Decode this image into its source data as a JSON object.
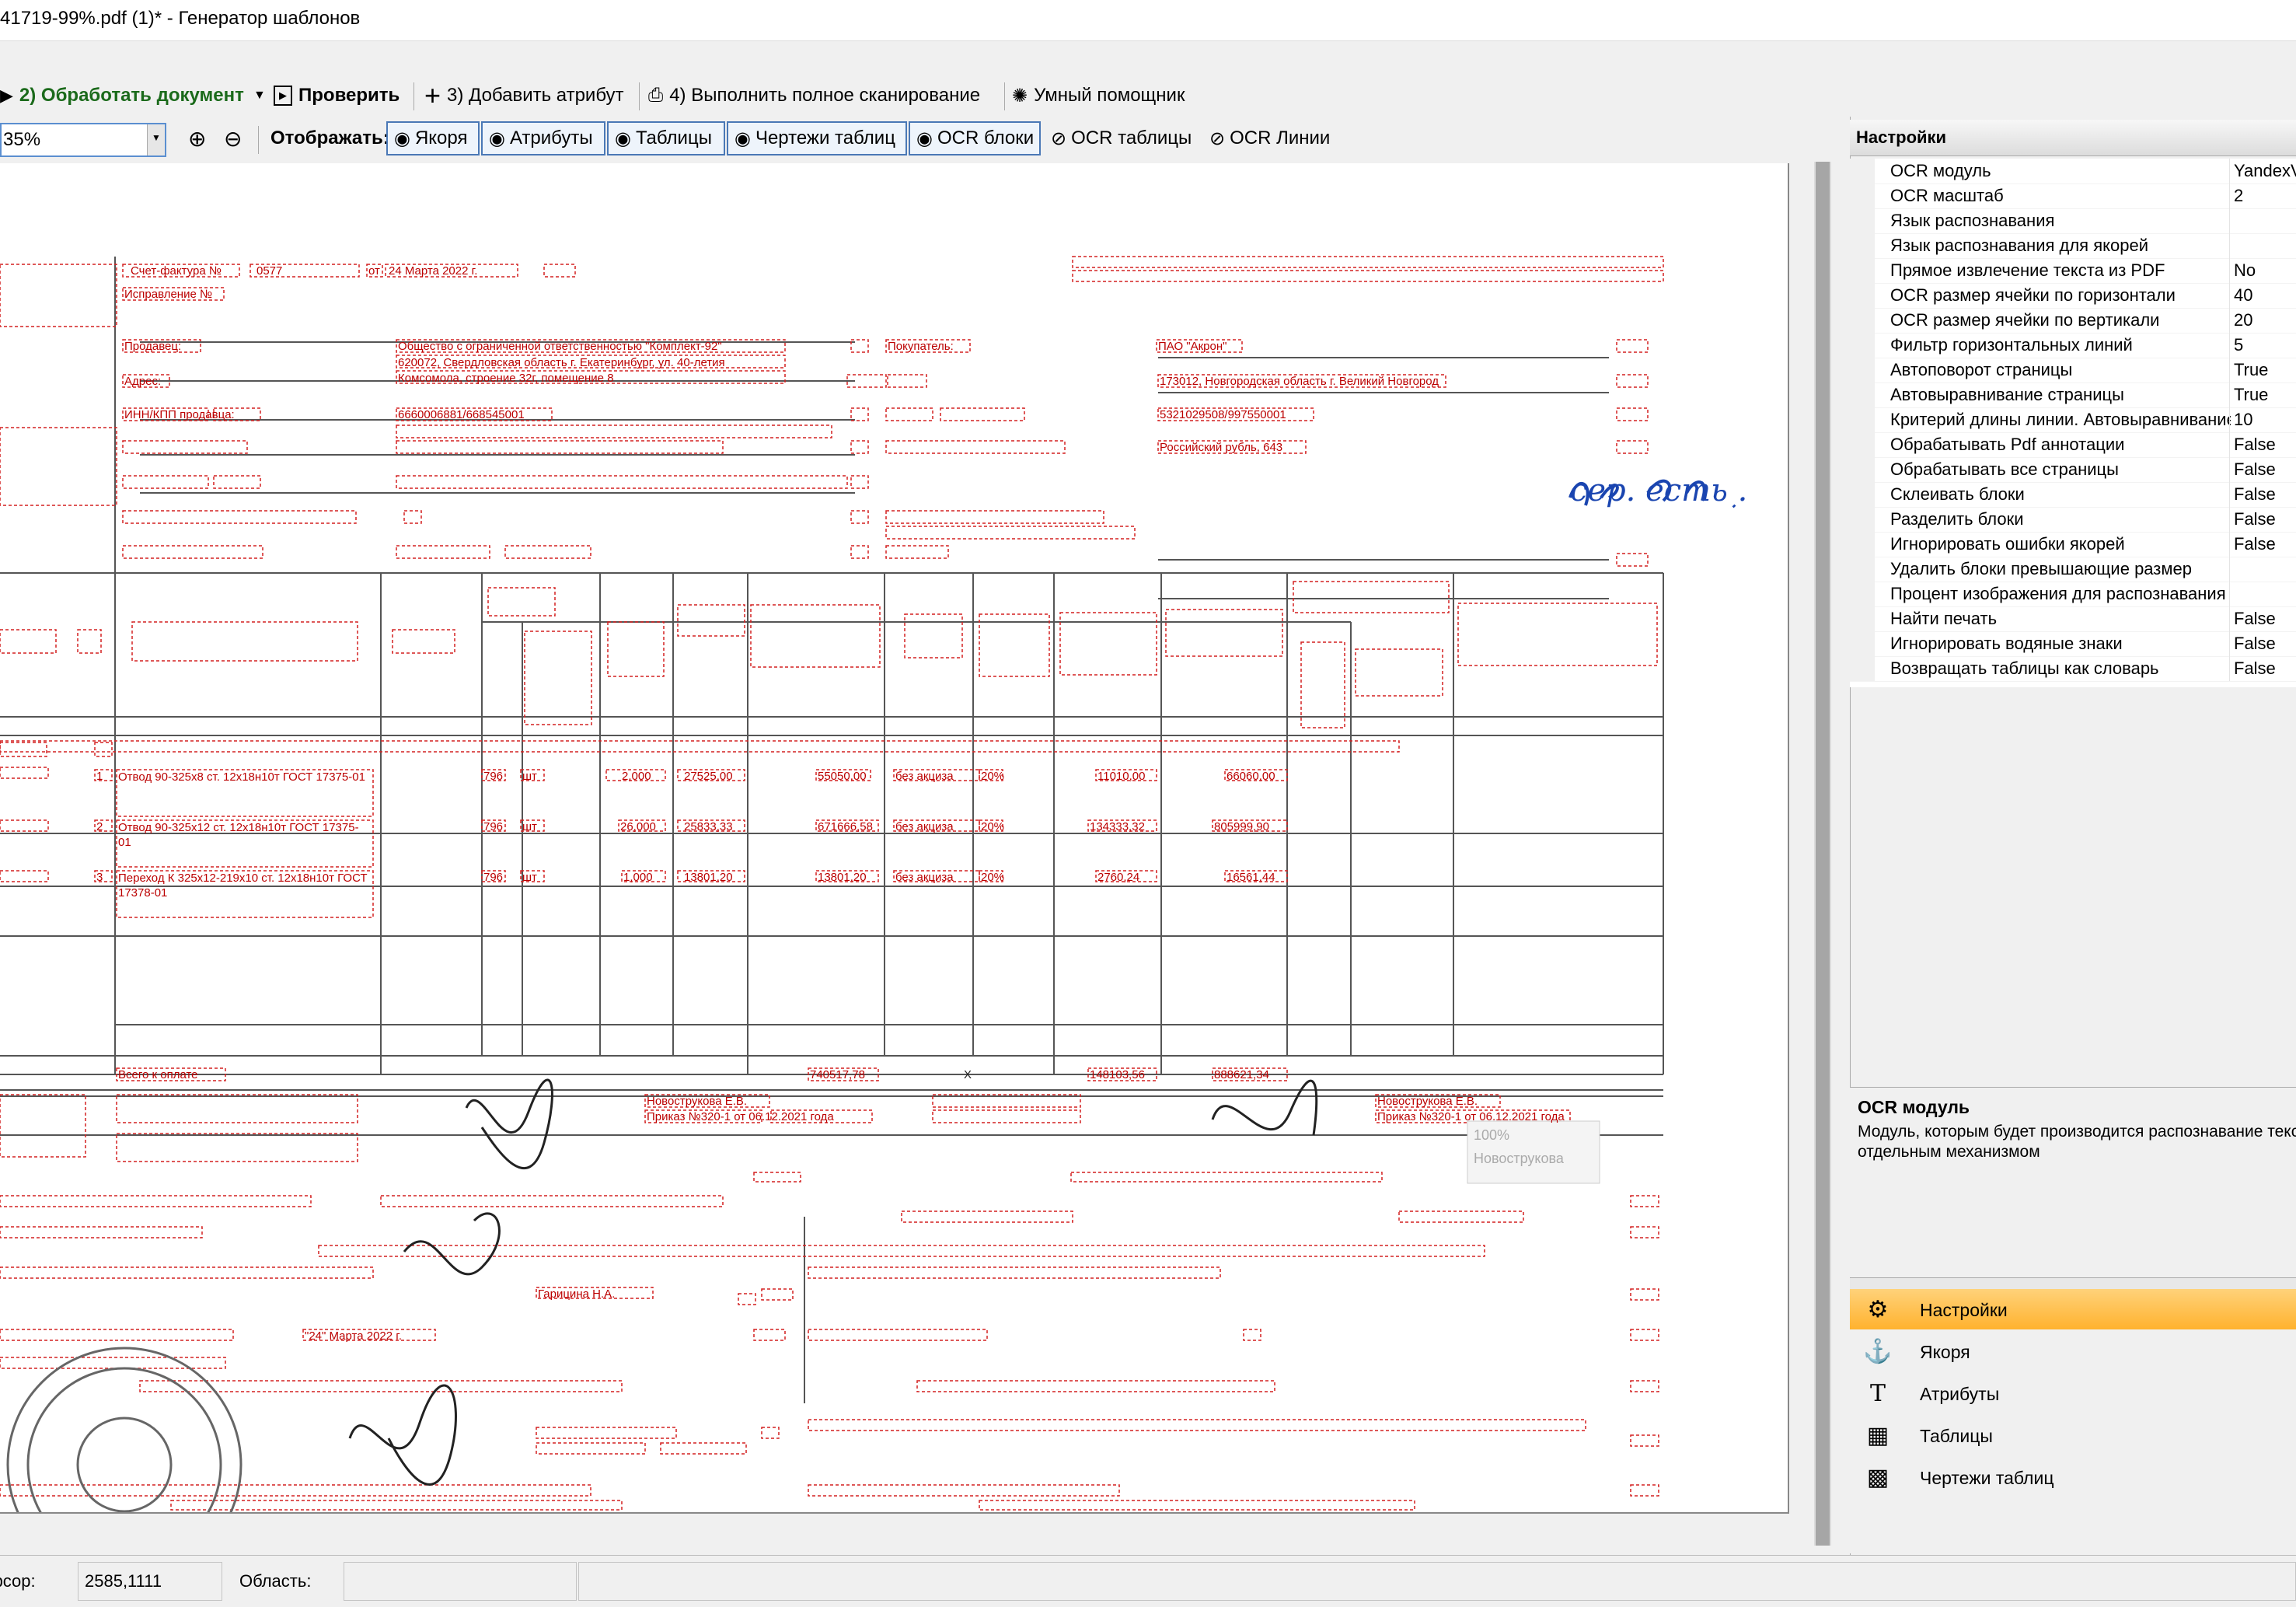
{
  "window": {
    "title": "41719-99%.pdf (1)* - Генератор шаблонов"
  },
  "toolbar": {
    "process": "2) Обработать документ",
    "check": "Проверить",
    "add_attr": "3) Добавить атрибут",
    "full_scan": "4) Выполнить полное сканирование",
    "assistant": "Умный помощник"
  },
  "view": {
    "zoom": "35%",
    "display_label": "Отображать:",
    "toggles": [
      "Якоря",
      "Атрибуты",
      "Таблицы",
      "Чертежи таблиц",
      "OCR блоки",
      "OCR таблицы",
      "OCR Линии"
    ]
  },
  "document": {
    "invoice_label": "Счет-фактура №",
    "invoice_no": "0577",
    "invoice_from": "от",
    "invoice_date": "24 Марта 2022 г.",
    "correction": "Исправление №",
    "seller_label": "Продавец:",
    "seller": "Общество с ограниченной ответственностью \"Комплект-92\"",
    "address_label": "Адрес:",
    "seller_addr": "620072, Свердловская область г. Екатеринбург, ул. 40-летия Комсомола, строение 32г, помещение 8",
    "inn_label": "ИНН/КПП продавца:",
    "seller_inn": "6660006881/668545001",
    "buyer_label": "Покупатель:",
    "buyer": "ПАО \"Акрон\"",
    "buyer_addr": "173012, Новгородская область г. Великий Новгород",
    "buyer_inn": "5321029508/997550001",
    "currency": "Российский рубль, 643",
    "handwritten": "сер. есть .",
    "rows": [
      {
        "n": "1",
        "name": "Отвод 90-325x8 ст. 12x18н10т ГОСТ 17375-01",
        "unit": "796",
        "uname": "шт",
        "qty": "2,000",
        "price": "27525,00",
        "sum": "55050,00",
        "excise": "без акциза",
        "tax": "20%",
        "vat": "11010,00",
        "total": "66060,00"
      },
      {
        "n": "2",
        "name": "Отвод 90-325x12 ст. 12x18н10т ГОСТ 17375-01",
        "unit": "796",
        "uname": "шт",
        "qty": "26,000",
        "price": "25833,33",
        "sum": "671666,58",
        "excise": "без акциза",
        "tax": "20%",
        "vat": "134333,32",
        "total": "805999,90"
      },
      {
        "n": "3",
        "name": "Переход К 325x12-219x10 ст. 12x18н10т ГОСТ 17378-01",
        "unit": "796",
        "uname": "шт",
        "qty": "1,000",
        "price": "13801,20",
        "sum": "13801,20",
        "excise": "без акциза",
        "tax": "20%",
        "vat": "2760,24",
        "total": "16561,44"
      }
    ],
    "total_label": "Всего к оплате",
    "total_sum": "740517,78",
    "total_x": "X",
    "total_vat": "148103,56",
    "total_all": "888621,34",
    "signer1": "Новострукова Е.В.",
    "signer2": "Новострукова Е.В.",
    "order": "Приказ №320-1 от 06.12.2021 года",
    "ship_date": "\"24\" Марта 2022 г.",
    "responsible": "Гарицина Н.А.",
    "overlay_pct": "100%",
    "overlay_name": "Новострукова"
  },
  "settings": {
    "header": "Настройки",
    "props": [
      {
        "name": "OCR модуль",
        "value": "YandexVision"
      },
      {
        "name": "OCR масштаб",
        "value": "2"
      },
      {
        "name": "Язык распознавания",
        "value": ""
      },
      {
        "name": "Язык распознавания для якорей",
        "value": ""
      },
      {
        "name": "Прямое извлечение текста из PDF",
        "value": "No"
      },
      {
        "name": "OCR размер ячейки по горизонтали",
        "value": "40"
      },
      {
        "name": "OCR размер ячейки по вертикали",
        "value": "20"
      },
      {
        "name": "Фильтр горизонтальных линий",
        "value": "5"
      },
      {
        "name": "Автоповорот страницы",
        "value": "True"
      },
      {
        "name": "Автовыравнивание страницы",
        "value": "True"
      },
      {
        "name": "Критерий длины линии. Автовыравнивание",
        "value": "10"
      },
      {
        "name": "Обрабатывать Pdf аннотации",
        "value": "False"
      },
      {
        "name": "Обрабатывать все страницы",
        "value": "False"
      },
      {
        "name": "Склеивать блоки",
        "value": "False"
      },
      {
        "name": "Разделить блоки",
        "value": "False"
      },
      {
        "name": "Игнорировать ошибки якорей",
        "value": "False"
      },
      {
        "name": "Удалить блоки превышающие размер",
        "value": ""
      },
      {
        "name": "Процент изображения для распознавания",
        "value": ""
      },
      {
        "name": "Найти печать",
        "value": "False"
      },
      {
        "name": "Игнорировать водяные знаки",
        "value": "False"
      },
      {
        "name": "Возвращать таблицы как словарь",
        "value": "False"
      }
    ],
    "desc_title": "OCR модуль",
    "desc_text": "Модуль, которым будет производится распознавание текста отдельным механизмом"
  },
  "nav": {
    "items": [
      "Настройки",
      "Якоря",
      "Атрибуты",
      "Таблицы",
      "Чертежи таблиц"
    ],
    "icons": [
      "gear-icon",
      "anchor-icon",
      "text-icon",
      "table-icon",
      "table-drawing-icon"
    ]
  },
  "status": {
    "cursor_label": "Курсор:",
    "cursor_value": "2585,1111",
    "area_label": "Область:",
    "area_value": ""
  }
}
